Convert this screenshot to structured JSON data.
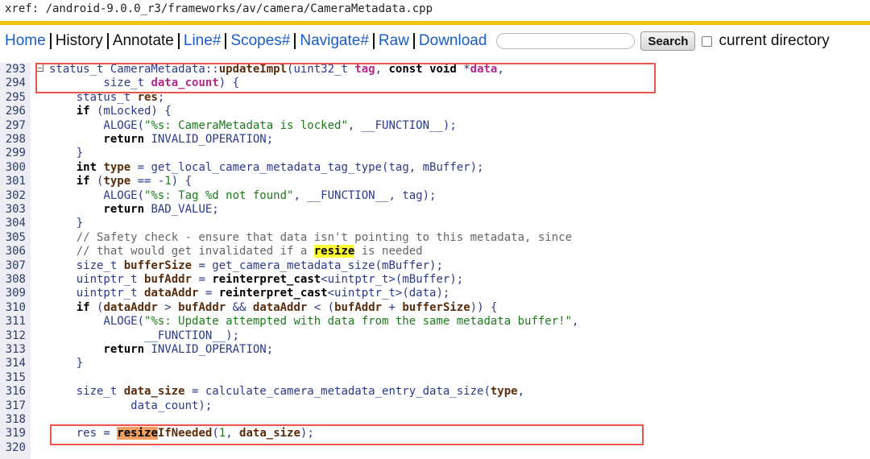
{
  "xref": {
    "path": "xref: /android-9.0.0_r3/frameworks/av/camera/CameraMetadata.cpp"
  },
  "nav": {
    "home": "Home",
    "history": "History",
    "annotate": "Annotate",
    "line": "Line#",
    "scopes": "Scopes#",
    "navigate": "Navigate#",
    "raw": "Raw",
    "download": "Download",
    "search_value": "",
    "search_button": "Search",
    "current_directory": "current directory"
  },
  "colors": {
    "accent_rule": "#f5c400",
    "link": "#1a5cc8",
    "highlight_box": "#e8564a",
    "search_highlight": "#ffff33",
    "current_highlight": "#f0a060"
  },
  "lines": [
    {
      "n": "293",
      "parts": [
        [
          "t",
          "status_t CameraMetadata::"
        ],
        [
          "f",
          "updateImpl"
        ],
        [
          "t",
          "("
        ],
        [
          "t",
          "uint32_t "
        ],
        [
          "p",
          "tag"
        ],
        [
          "t",
          ", "
        ],
        [
          "k",
          "const"
        ],
        [
          "t",
          " "
        ],
        [
          "k",
          "void"
        ],
        [
          "t",
          " *"
        ],
        [
          "p",
          "data"
        ],
        [
          "t",
          ","
        ]
      ]
    },
    {
      "n": "294",
      "parts": [
        [
          "t",
          "        size_t "
        ],
        [
          "p",
          "data_count"
        ],
        [
          "t",
          ") {"
        ]
      ]
    },
    {
      "n": "295",
      "parts": [
        [
          "t",
          "    status_t "
        ],
        [
          "f",
          "res"
        ],
        [
          "t",
          ";"
        ]
      ]
    },
    {
      "n": "296",
      "parts": [
        [
          "k",
          "    if"
        ],
        [
          "t",
          " (mLocked) {"
        ]
      ]
    },
    {
      "n": "297",
      "parts": [
        [
          "t",
          "        ALOGE("
        ],
        [
          "s",
          "\"%s: CameraMetadata is locked\""
        ],
        [
          "t",
          ", __FUNCTION__);"
        ]
      ]
    },
    {
      "n": "298",
      "parts": [
        [
          "k",
          "        return"
        ],
        [
          "t",
          " INVALID_OPERATION;"
        ]
      ]
    },
    {
      "n": "299",
      "parts": [
        [
          "t",
          "    }"
        ]
      ]
    },
    {
      "n": "300",
      "parts": [
        [
          "k",
          "    int"
        ],
        [
          "t",
          " "
        ],
        [
          "f",
          "type"
        ],
        [
          "t",
          " = get_local_camera_metadata_tag_type(tag, mBuffer);"
        ]
      ]
    },
    {
      "n": "301",
      "parts": [
        [
          "k",
          "    if"
        ],
        [
          "t",
          " ("
        ],
        [
          "f",
          "type"
        ],
        [
          "t",
          " == -"
        ],
        [
          "m",
          "1"
        ],
        [
          "t",
          ") {"
        ]
      ]
    },
    {
      "n": "302",
      "parts": [
        [
          "t",
          "        ALOGE("
        ],
        [
          "s",
          "\"%s: Tag %d not found\""
        ],
        [
          "t",
          ", __FUNCTION__, tag);"
        ]
      ]
    },
    {
      "n": "303",
      "parts": [
        [
          "k",
          "        return"
        ],
        [
          "t",
          " BAD_VALUE;"
        ]
      ]
    },
    {
      "n": "304",
      "parts": [
        [
          "t",
          "    }"
        ]
      ]
    },
    {
      "n": "305",
      "parts": [
        [
          "c",
          "    // Safety check - ensure that data isn't pointing to this metadata, since"
        ]
      ]
    },
    {
      "n": "306",
      "parts": [
        [
          "c",
          "    // that would get invalidated if a "
        ],
        [
          "y",
          "resize"
        ],
        [
          "c",
          " is needed"
        ]
      ]
    },
    {
      "n": "307",
      "parts": [
        [
          "t",
          "    size_t "
        ],
        [
          "f",
          "bufferSize"
        ],
        [
          "t",
          " = get_camera_metadata_size(mBuffer);"
        ]
      ]
    },
    {
      "n": "308",
      "parts": [
        [
          "t",
          "    uintptr_t "
        ],
        [
          "f",
          "bufAddr"
        ],
        [
          "t",
          " = "
        ],
        [
          "k",
          "reinterpret_cast"
        ],
        [
          "t",
          "<uintptr_t>(mBuffer);"
        ]
      ]
    },
    {
      "n": "309",
      "parts": [
        [
          "t",
          "    uintptr_t "
        ],
        [
          "f",
          "dataAddr"
        ],
        [
          "t",
          " = "
        ],
        [
          "k",
          "reinterpret_cast"
        ],
        [
          "t",
          "<uintptr_t>(data);"
        ]
      ]
    },
    {
      "n": "310",
      "parts": [
        [
          "k",
          "    if"
        ],
        [
          "t",
          " ("
        ],
        [
          "f",
          "dataAddr"
        ],
        [
          "t",
          " > "
        ],
        [
          "f",
          "bufAddr"
        ],
        [
          "t",
          " && "
        ],
        [
          "f",
          "dataAddr"
        ],
        [
          "t",
          " < ("
        ],
        [
          "f",
          "bufAddr"
        ],
        [
          "t",
          " + "
        ],
        [
          "f",
          "bufferSize"
        ],
        [
          "t",
          ")) {"
        ]
      ]
    },
    {
      "n": "311",
      "parts": [
        [
          "t",
          "        ALOGE("
        ],
        [
          "s",
          "\"%s: Update attempted with data from the same metadata buffer!\""
        ],
        [
          "t",
          ","
        ]
      ]
    },
    {
      "n": "312",
      "parts": [
        [
          "t",
          "              __FUNCTION__);"
        ]
      ]
    },
    {
      "n": "313",
      "parts": [
        [
          "k",
          "        return"
        ],
        [
          "t",
          " INVALID_OPERATION;"
        ]
      ]
    },
    {
      "n": "314",
      "parts": [
        [
          "t",
          "    }"
        ]
      ]
    },
    {
      "n": "315",
      "parts": [
        [
          "t",
          ""
        ]
      ]
    },
    {
      "n": "316",
      "parts": [
        [
          "t",
          "    size_t "
        ],
        [
          "f",
          "data_size"
        ],
        [
          "t",
          " = calculate_camera_metadata_entry_data_size("
        ],
        [
          "f",
          "type"
        ],
        [
          "t",
          ","
        ]
      ]
    },
    {
      "n": "317",
      "parts": [
        [
          "t",
          "            data_count);"
        ]
      ]
    },
    {
      "n": "318",
      "parts": [
        [
          "t",
          ""
        ]
      ]
    },
    {
      "n": "319",
      "parts": [
        [
          "t",
          "    res = "
        ],
        [
          "o",
          "resize"
        ],
        [
          "f",
          "IfNeeded"
        ],
        [
          "t",
          "("
        ],
        [
          "m",
          "1"
        ],
        [
          "t",
          ", "
        ],
        [
          "f",
          "data_size"
        ],
        [
          "t",
          ");"
        ]
      ]
    },
    {
      "n": "320",
      "parts": [
        [
          "t",
          ""
        ]
      ]
    }
  ]
}
